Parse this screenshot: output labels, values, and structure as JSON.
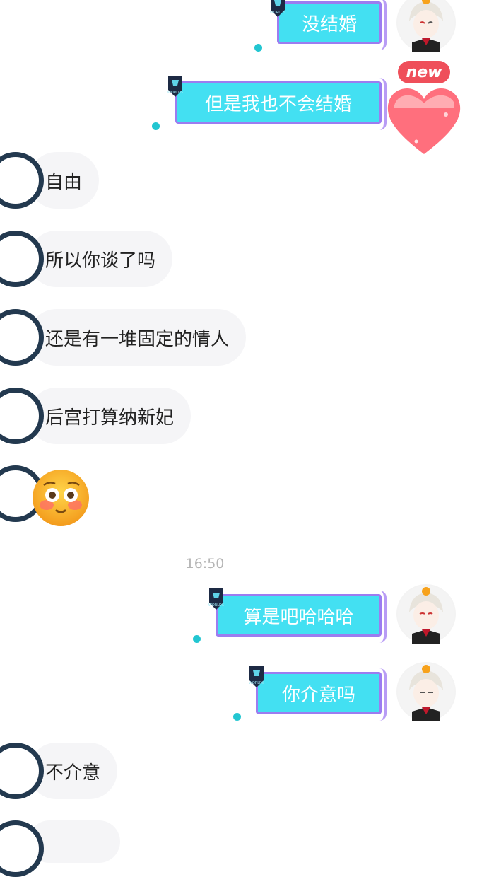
{
  "messages": {
    "out_1": "没结婚",
    "out_2": "但是我也不会结婚",
    "in_1": "自由",
    "in_2": "所以你谈了吗",
    "in_3": "还是有一堆固定的情人",
    "in_4": "后宫打算纳新妃",
    "out_3": "算是吧哈哈哈",
    "out_4": "你介意吗",
    "in_5": "不介意"
  },
  "timestamp": "16:50",
  "new_badge": "new",
  "badge_text": "WORLDS",
  "icons": {
    "emoji": "flushed-face-emoji",
    "out_avatar": "cartoon-vampire-avatar",
    "in_avatar": "contact-avatar",
    "heart": "heart-avatar-frame"
  },
  "colors": {
    "out_bubble": "#43e0f2",
    "out_border": "#9c7cf0",
    "in_bubble": "#f5f5f7",
    "dot": "#22c6d1",
    "new_badge": "#ef4f5a"
  }
}
